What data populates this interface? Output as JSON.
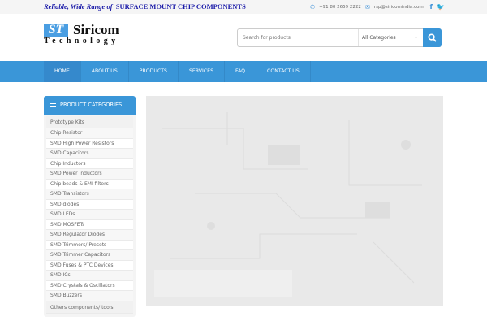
{
  "topbar": {
    "tagline_italic": "Reliable, Wide Range of",
    "tagline_bold": "SURFACE MOUNT CHIP COMPONENTS",
    "phone": "+91 80 2659 2222",
    "email": "rsp@siricomindia.com"
  },
  "logo": {
    "mark": "ST",
    "name": "Siricom",
    "sub": "Technology"
  },
  "search": {
    "placeholder": "Search for products",
    "category": "All Categories"
  },
  "nav": [
    "HOME",
    "ABOUT US",
    "PRODUCTS",
    "SERVICES",
    "FAQ",
    "CONTACT US"
  ],
  "sidebar": {
    "title": "PRODUCT CATEGORIES",
    "items": [
      "Prototype Kits",
      "Chip Resistor",
      "SMD High Power Resistors",
      "SMD Capacitors",
      "Chip Inductors",
      "SMD Power Inductors",
      "Chip beads & EMI filters",
      "SMD Transistors",
      "SMD diodes",
      "SMD LEDs",
      "SMD MOSFETs",
      "SMD Regulator Diodes",
      "SMD Trimmers/ Presets",
      "SMD Trimmer Capacitors",
      "SMD Fuses & PTC Devices",
      "SMD ICs",
      "SMD Crystals & Oscillators",
      "SMD Buzzers",
      "Others components/ tools"
    ]
  }
}
